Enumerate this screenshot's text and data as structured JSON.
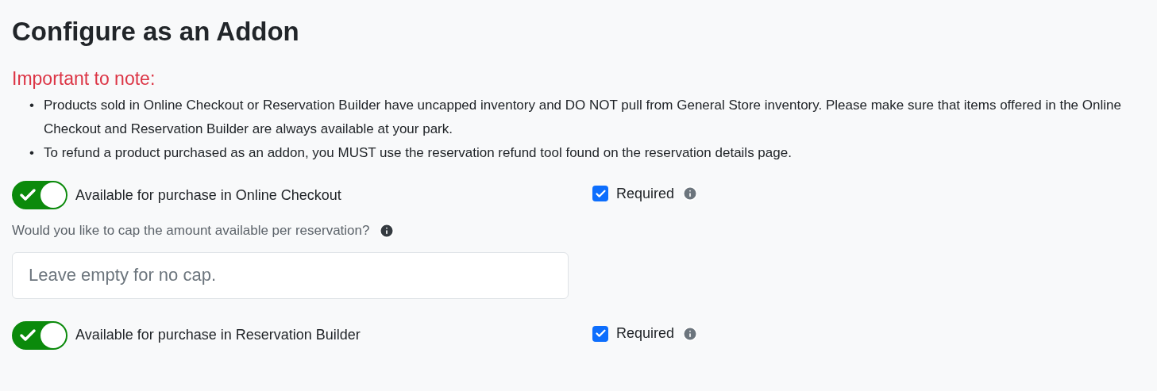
{
  "title": "Configure as an Addon",
  "note": {
    "heading": "Important to note:",
    "items": [
      {
        "bullet": "•",
        "text": "Products sold in Online Checkout or Reservation Builder have uncapped inventory and DO NOT pull from General Store inventory. Please make sure that items offered in the Online Checkout and Reservation Builder are always available at your park."
      },
      {
        "bullet": "•",
        "text": "To refund a product purchased as an addon, you MUST use the reservation refund tool found on the reservation details page."
      }
    ]
  },
  "addons": [
    {
      "label": "Available for purchase in Online Checkout",
      "on": true,
      "required": {
        "label": "Required",
        "checked": true
      },
      "cap": {
        "question": "Would you like to cap the amount available per reservation?",
        "placeholder": "Leave empty for no cap."
      }
    },
    {
      "label": "Available for purchase in Reservation Builder",
      "on": true,
      "required": {
        "label": "Required",
        "checked": true
      }
    }
  ]
}
